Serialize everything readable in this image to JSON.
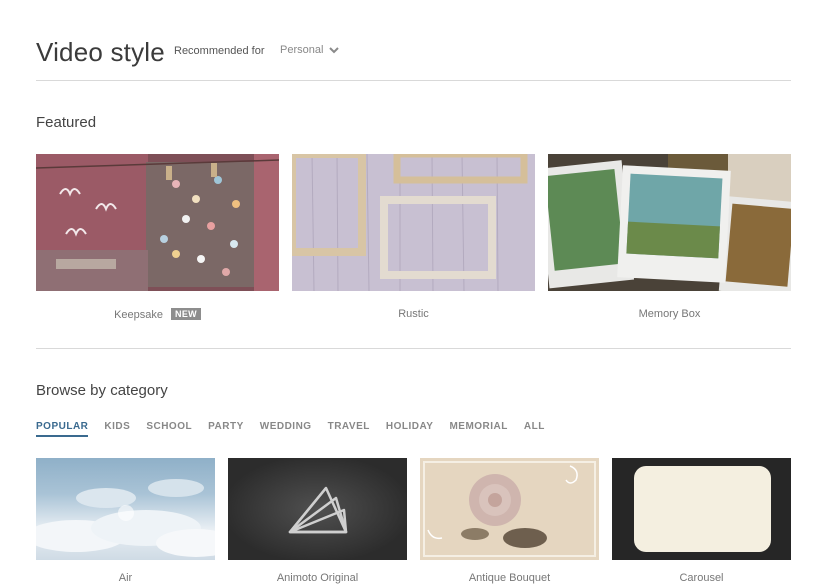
{
  "header": {
    "title": "Video style",
    "recommended_label": "Recommended for",
    "recommended_value": "Personal"
  },
  "featured": {
    "title": "Featured",
    "items": [
      {
        "label": "Keepsake",
        "badge": "NEW"
      },
      {
        "label": "Rustic"
      },
      {
        "label": "Memory Box"
      }
    ]
  },
  "browse": {
    "title": "Browse by category",
    "tabs": [
      "POPULAR",
      "KIDS",
      "SCHOOL",
      "PARTY",
      "WEDDING",
      "TRAVEL",
      "HOLIDAY",
      "MEMORIAL",
      "ALL"
    ],
    "active_tab": "POPULAR",
    "items": [
      {
        "label": "Air"
      },
      {
        "label": "Animoto Original"
      },
      {
        "label": "Antique Bouquet"
      },
      {
        "label": "Carousel"
      }
    ]
  },
  "colors": {
    "accent": "#3a6a8f",
    "badge_bg": "#8d8d8d",
    "divider": "#d9d9d9"
  }
}
